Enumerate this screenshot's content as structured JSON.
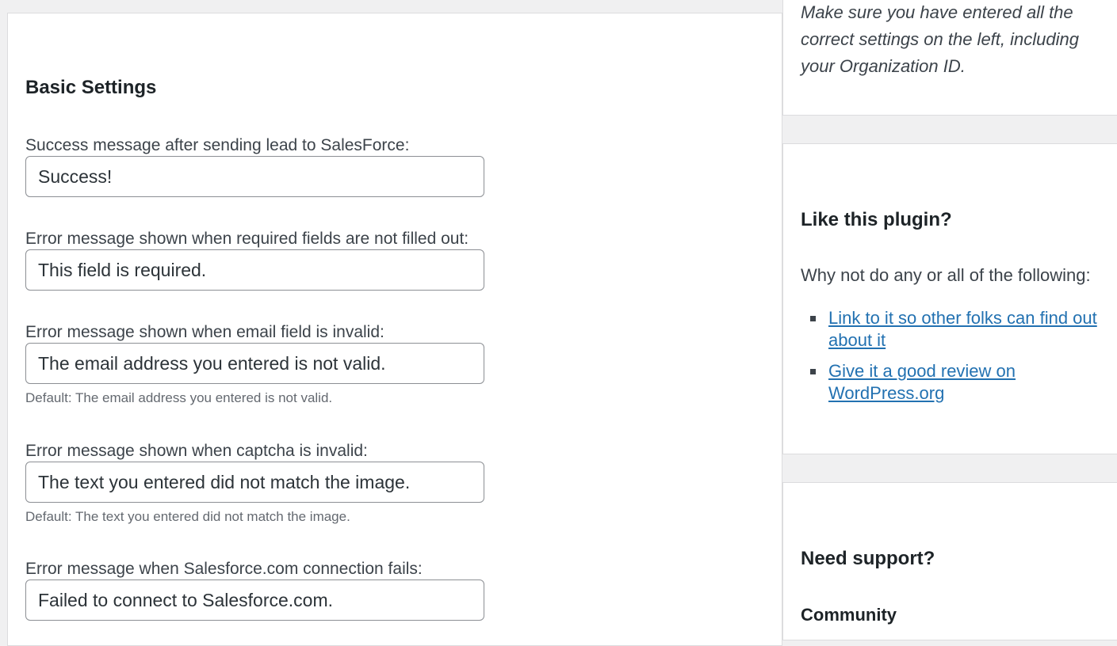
{
  "settings": {
    "section_title": "Basic Settings",
    "fields": [
      {
        "label": "Success message after sending lead to SalesForce:",
        "value": "Success!"
      },
      {
        "label": "Error message shown when required fields are not filled out:",
        "value": "This field is required."
      },
      {
        "label": "Error message shown when email field is invalid:",
        "value": "The email address you entered is not valid.",
        "hint": "Default: The email address you entered is not valid."
      },
      {
        "label": "Error message shown when captcha is invalid:",
        "value": "The text you entered did not match the image.",
        "hint": "Default: The text you entered did not match the image."
      },
      {
        "label": "Error message when Salesforce.com connection fails:",
        "value": "Failed to connect to Salesforce.com."
      }
    ]
  },
  "sidebar": {
    "note": "Make sure you have entered all the correct settings on the left, including your Organization ID.",
    "plugin_box": {
      "heading": "Like this plugin?",
      "intro": "Why not do any or all of the following:",
      "links": [
        "Link to it so other folks can find out about it",
        "Give it a good review on WordPress.org"
      ]
    },
    "support_box": {
      "heading": "Need support?",
      "subheading": "Community"
    }
  },
  "colors": {
    "link": "#2271b1",
    "background": "#f0f0f1",
    "panel": "#ffffff",
    "border": "#dcdcde"
  }
}
